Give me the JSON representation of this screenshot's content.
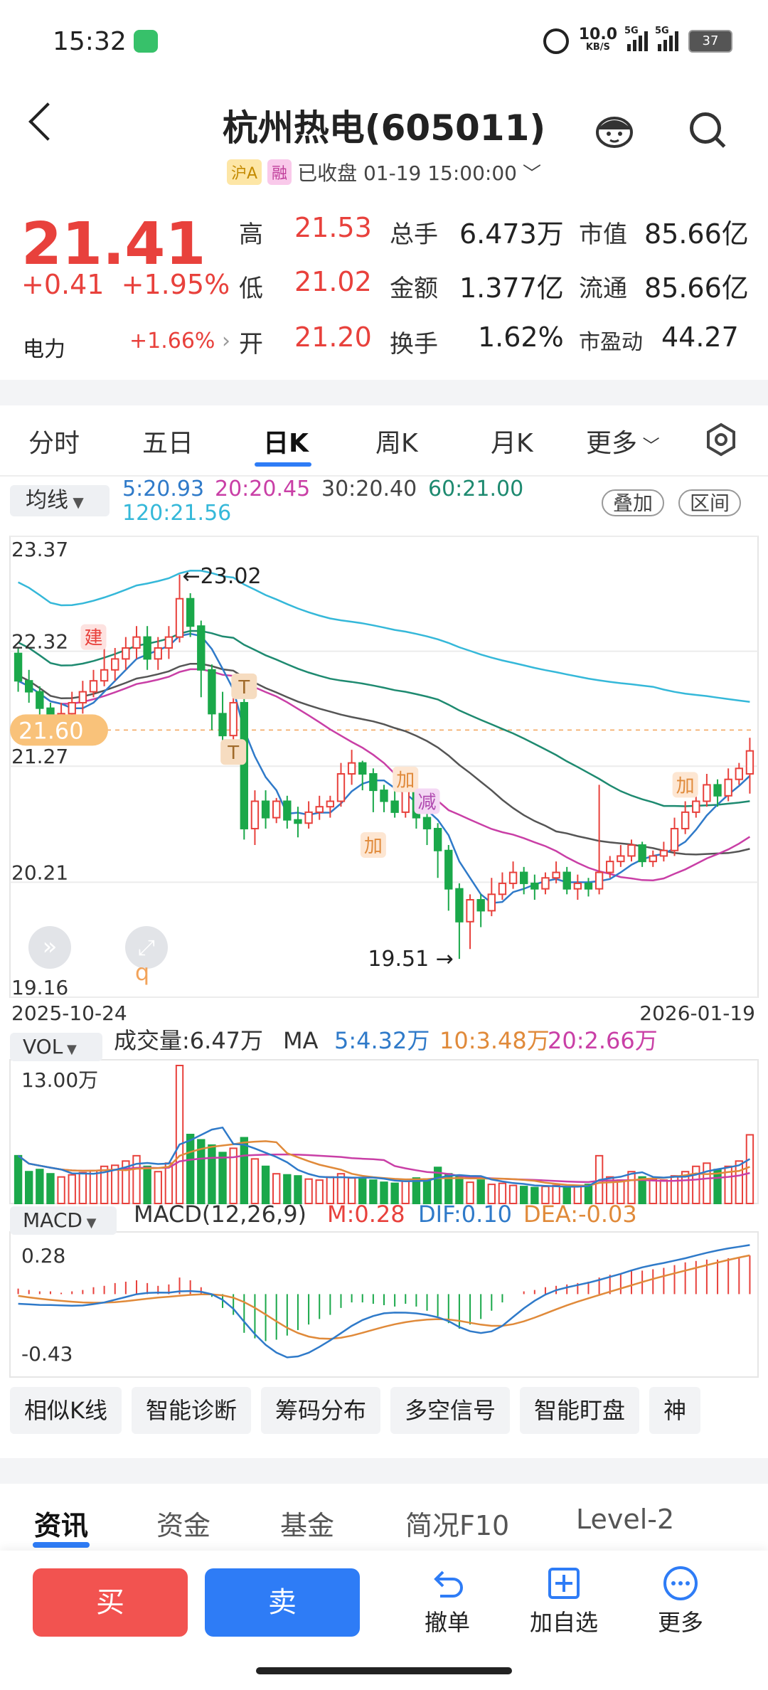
{
  "status": {
    "time": "15:32",
    "net_speed": "10.0",
    "net_unit": "KB/S",
    "sig1": "5G",
    "sig2": "5G",
    "battery": "37"
  },
  "header": {
    "title": "杭州热电(605011)",
    "tag_sh": "沪A",
    "tag_rz": "融",
    "status": "已收盘 01-19 15:00:00"
  },
  "quote": {
    "price": "21.41",
    "change": "+0.41",
    "change_pct": "+1.95%",
    "dianli_label": "电力",
    "dianli_value": "+1.66%",
    "rows": [
      {
        "l1": "高",
        "v1": "21.53",
        "l2": "总手",
        "v2": "6.473万",
        "l3": "市值",
        "v3": "85.66亿"
      },
      {
        "l1": "低",
        "v1": "21.02",
        "l2": "金额",
        "v2": "1.377亿",
        "l3": "流通",
        "v3": "85.66亿"
      },
      {
        "l1": "开",
        "v1": "21.20",
        "l2": "换手",
        "v2": "1.62%",
        "l3": "市盈动",
        "v3": "44.27"
      }
    ]
  },
  "tabs": [
    "分时",
    "五日",
    "日K",
    "周K",
    "月K",
    "更多"
  ],
  "ma": {
    "button": "均线",
    "ma5": "5:20.93",
    "ma20": "20:20.45",
    "ma30": "30:20.40",
    "ma60": "60:21.00",
    "ma120": "120:21.56",
    "overlay": "叠加",
    "interval": "区间",
    "colors": {
      "ma5": "#2f7ac9",
      "ma20": "#c93fa6",
      "ma30": "#555555",
      "ma60": "#1e8a70",
      "ma120": "#35b8d9"
    }
  },
  "chart_data": [
    {
      "type": "candlestick",
      "ylim": [
        19.16,
        23.37
      ],
      "y_ticks": [
        "23.37",
        "22.32",
        "21.27",
        "20.21",
        "19.16"
      ],
      "x_start": "2025-10-24",
      "x_end": "2026-01-19",
      "current_price_label": "21.60",
      "high_annotation": "←23.02",
      "low_annotation": "19.51 →",
      "markers": [
        "建",
        "T",
        "T",
        "加",
        "加",
        "减",
        "加"
      ],
      "candles": [
        [
          22.3,
          22.05,
          22.35,
          21.95
        ],
        [
          22.05,
          21.95,
          22.15,
          21.85
        ],
        [
          21.95,
          21.8,
          22.0,
          21.7
        ],
        [
          21.8,
          21.65,
          21.85,
          21.55
        ],
        [
          21.65,
          21.75,
          21.85,
          21.6
        ],
        [
          21.75,
          21.85,
          21.95,
          21.7
        ],
        [
          21.85,
          21.95,
          22.05,
          21.75
        ],
        [
          21.95,
          22.05,
          22.15,
          21.9
        ],
        [
          22.05,
          22.15,
          22.45,
          22.0
        ],
        [
          22.15,
          22.25,
          22.35,
          22.05
        ],
        [
          22.25,
          22.35,
          22.45,
          22.15
        ],
        [
          22.35,
          22.45,
          22.55,
          22.25
        ],
        [
          22.45,
          22.25,
          22.55,
          22.15
        ],
        [
          22.25,
          22.35,
          22.45,
          22.15
        ],
        [
          22.35,
          22.45,
          22.55,
          22.25
        ],
        [
          22.45,
          22.8,
          23.02,
          22.4
        ],
        [
          22.8,
          22.55,
          22.85,
          22.45
        ],
        [
          22.55,
          22.15,
          22.6,
          21.9
        ],
        [
          22.15,
          21.75,
          22.2,
          21.6
        ],
        [
          21.75,
          21.55,
          21.95,
          21.4
        ],
        [
          21.55,
          21.85,
          21.95,
          21.5
        ],
        [
          21.85,
          20.7,
          21.95,
          20.6
        ],
        [
          20.7,
          20.95,
          21.05,
          20.55
        ],
        [
          20.95,
          20.8,
          21.05,
          20.7
        ],
        [
          20.8,
          20.95,
          20.98,
          20.75
        ],
        [
          20.95,
          20.78,
          21.0,
          20.7
        ],
        [
          20.78,
          20.75,
          20.9,
          20.62
        ],
        [
          20.75,
          20.85,
          20.95,
          20.7
        ],
        [
          20.85,
          20.9,
          21.0,
          20.78
        ],
        [
          20.9,
          20.95,
          21.0,
          20.8
        ],
        [
          20.95,
          21.2,
          21.3,
          20.9
        ],
        [
          21.2,
          21.3,
          21.42,
          21.1
        ],
        [
          21.3,
          21.2,
          21.32,
          21.05
        ],
        [
          21.2,
          21.05,
          21.25,
          20.85
        ],
        [
          21.05,
          20.95,
          21.1,
          20.85
        ],
        [
          20.95,
          20.85,
          21.05,
          20.8
        ],
        [
          20.85,
          21.05,
          21.15,
          20.8
        ],
        [
          21.05,
          20.8,
          21.1,
          20.7
        ],
        [
          20.8,
          20.7,
          20.85,
          20.55
        ],
        [
          20.7,
          20.5,
          20.75,
          20.25
        ],
        [
          20.5,
          20.15,
          20.55,
          19.95
        ],
        [
          20.15,
          19.85,
          20.2,
          19.51
        ],
        [
          19.85,
          20.05,
          20.1,
          19.6
        ],
        [
          20.05,
          19.95,
          20.1,
          19.8
        ],
        [
          19.95,
          20.1,
          20.25,
          19.9
        ],
        [
          20.1,
          20.2,
          20.3,
          20.05
        ],
        [
          20.2,
          20.3,
          20.4,
          20.15
        ],
        [
          20.3,
          20.2,
          20.35,
          20.1
        ],
        [
          20.2,
          20.15,
          20.28,
          20.05
        ],
        [
          20.15,
          20.25,
          20.3,
          20.1
        ],
        [
          20.25,
          20.3,
          20.4,
          20.2
        ],
        [
          20.3,
          20.15,
          20.35,
          20.1
        ],
        [
          20.15,
          20.2,
          20.28,
          20.05
        ],
        [
          20.2,
          20.15,
          20.25,
          20.08
        ],
        [
          20.15,
          20.3,
          21.1,
          20.1
        ],
        [
          20.3,
          20.4,
          20.45,
          20.25
        ],
        [
          20.4,
          20.45,
          20.55,
          20.35
        ],
        [
          20.45,
          20.55,
          20.6,
          20.4
        ],
        [
          20.55,
          20.4,
          20.58,
          20.35
        ],
        [
          20.4,
          20.45,
          20.5,
          20.35
        ],
        [
          20.45,
          20.5,
          20.58,
          20.4
        ],
        [
          20.5,
          20.7,
          20.8,
          20.45
        ],
        [
          20.7,
          20.85,
          20.95,
          20.65
        ],
        [
          20.85,
          20.95,
          21.05,
          20.8
        ],
        [
          20.95,
          21.1,
          21.2,
          20.9
        ],
        [
          21.1,
          21.0,
          21.15,
          20.9
        ],
        [
          21.0,
          21.15,
          21.25,
          20.95
        ],
        [
          21.15,
          21.25,
          21.3,
          21.1
        ],
        [
          21.2,
          21.41,
          21.53,
          21.02
        ]
      ]
    },
    {
      "type": "bar",
      "name": "VOL",
      "label": "成交量:6.47万",
      "ma_label": "MA",
      "ma5": "5:4.32万",
      "ma10": "10:3.48万",
      "ma20": "20:2.66万",
      "y_max_label": "13.00万",
      "ylim": [
        0,
        13.0
      ],
      "values": [
        4.5,
        3.0,
        3.2,
        2.8,
        2.5,
        2.7,
        2.9,
        3.1,
        3.5,
        3.6,
        4.0,
        4.5,
        3.5,
        3.0,
        3.8,
        13.0,
        6.5,
        6.0,
        5.5,
        4.8,
        5.2,
        6.2,
        4.2,
        3.5,
        2.8,
        2.7,
        2.6,
        2.3,
        2.2,
        2.5,
        2.8,
        2.4,
        2.3,
        2.2,
        2.0,
        1.9,
        2.1,
        2.4,
        2.3,
        3.4,
        2.8,
        2.5,
        2.0,
        2.2,
        1.8,
        1.9,
        1.7,
        1.6,
        1.5,
        1.6,
        1.7,
        1.5,
        1.6,
        1.8,
        4.5,
        2.5,
        2.2,
        3.0,
        2.5,
        2.3,
        2.2,
        2.6,
        3.0,
        3.5,
        3.8,
        3.2,
        3.5,
        4.0,
        6.47
      ]
    },
    {
      "type": "bar",
      "name": "MACD",
      "label": "MACD(12,26,9)",
      "m_label": "M:0.28",
      "dif_label": "DIF:0.10",
      "dea_label": "DEA:-0.03",
      "y_ticks": [
        "0.28",
        "-0.43"
      ],
      "ylim": [
        -0.6,
        0.45
      ],
      "values": [
        0.04,
        0.03,
        0.02,
        0.02,
        0.01,
        0.02,
        0.03,
        0.05,
        0.06,
        0.08,
        0.09,
        0.1,
        0.08,
        0.06,
        0.07,
        0.12,
        0.1,
        0.05,
        -0.02,
        -0.1,
        -0.15,
        -0.28,
        -0.32,
        -0.34,
        -0.33,
        -0.3,
        -0.26,
        -0.22,
        -0.18,
        -0.15,
        -0.1,
        -0.06,
        -0.06,
        -0.07,
        -0.08,
        -0.09,
        -0.07,
        -0.09,
        -0.12,
        -0.16,
        -0.21,
        -0.25,
        -0.22,
        -0.18,
        -0.12,
        -0.06,
        0.0,
        0.02,
        0.03,
        0.05,
        0.06,
        0.07,
        0.08,
        0.09,
        0.12,
        0.14,
        0.15,
        0.17,
        0.17,
        0.18,
        0.19,
        0.21,
        0.23,
        0.24,
        0.25,
        0.25,
        0.26,
        0.27,
        0.28
      ]
    }
  ],
  "indicator_buttons": {
    "vol": "VOL",
    "macd": "MACD"
  },
  "chips": [
    "相似K线",
    "智能诊断",
    "筹码分布",
    "多空信号",
    "智能盯盘",
    "神"
  ],
  "info_tabs": [
    "资讯",
    "资金",
    "基金",
    "简况F10",
    "Level-2"
  ],
  "actions": {
    "buy": "买",
    "sell": "卖",
    "revoke": "撤单",
    "add_watch": "加自选",
    "more": "更多"
  }
}
